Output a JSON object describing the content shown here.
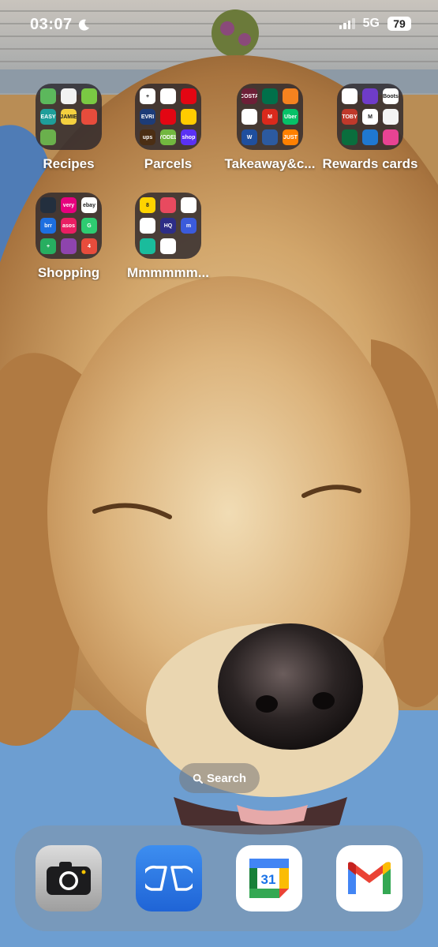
{
  "status_bar": {
    "time": "03:07",
    "network": "5G",
    "battery": "79"
  },
  "folders": [
    {
      "label": "Recipes",
      "apps": [
        {
          "name": "basket-app-icon",
          "color": "#5cb85c",
          "text": ""
        },
        {
          "name": "bowl-app-icon",
          "color": "#f2f2f2",
          "text": ""
        },
        {
          "name": "heart-app-icon",
          "color": "#7ac943",
          "text": ""
        },
        {
          "name": "easy-meals-app-icon",
          "color": "#1e9e9a",
          "text": "EASY"
        },
        {
          "name": "jamie-oliver-app-icon",
          "color": "#f4d03f",
          "text": "JAMIE"
        },
        {
          "name": "berry-app-icon",
          "color": "#e74c3c",
          "text": ""
        },
        {
          "name": "green-basket-app-icon",
          "color": "#6ab04c",
          "text": ""
        }
      ]
    },
    {
      "label": "Parcels",
      "apps": [
        {
          "name": "plus-app-icon",
          "color": "#ffffff",
          "text": "+"
        },
        {
          "name": "drop-app-icon",
          "color": "#ffffff",
          "text": ""
        },
        {
          "name": "royal-mail-app-icon",
          "color": "#e30613",
          "text": ""
        },
        {
          "name": "evri-app-icon",
          "color": "#1d3c78",
          "text": "EVRI"
        },
        {
          "name": "post-office-app-icon",
          "color": "#e30613",
          "text": ""
        },
        {
          "name": "dhl-app-icon",
          "color": "#ffcc00",
          "text": ""
        },
        {
          "name": "ups-app-icon",
          "color": "#4b2e14",
          "text": "ups"
        },
        {
          "name": "yodel-app-icon",
          "color": "#72b73f",
          "text": "YODEL"
        },
        {
          "name": "shop-app-icon",
          "color": "#5a31f4",
          "text": "shop"
        }
      ]
    },
    {
      "label": "Takeaway&c...",
      "apps": [
        {
          "name": "costa-app-icon",
          "color": "#6d1f37",
          "text": "COSTA"
        },
        {
          "name": "starbucks-app-icon",
          "color": "#00704a",
          "text": ""
        },
        {
          "name": "home-app-icon",
          "color": "#f5821f",
          "text": ""
        },
        {
          "name": "kfc-app-icon",
          "color": "#ffffff",
          "text": ""
        },
        {
          "name": "mcdonalds-app-icon",
          "color": "#da291c",
          "text": "M"
        },
        {
          "name": "uber-eats-app-icon",
          "color": "#06c167",
          "text": "Uber"
        },
        {
          "name": "wetherspoons-app-icon",
          "color": "#1f4f9e",
          "text": "W"
        },
        {
          "name": "grid-app-icon",
          "color": "#2c5aa0",
          "text": ""
        },
        {
          "name": "just-eat-app-icon",
          "color": "#ff8000",
          "text": "JUST"
        }
      ]
    },
    {
      "label": "Rewards cards",
      "apps": [
        {
          "name": "boots-app-icon",
          "color": "#ffffff",
          "text": ""
        },
        {
          "name": "bubble-app-icon",
          "color": "#6f3cc9",
          "text": ""
        },
        {
          "name": "boots-advantage-app-icon",
          "color": "#ffffff",
          "text": "Boots"
        },
        {
          "name": "toby-app-icon",
          "color": "#c0392b",
          "text": "TOBY"
        },
        {
          "name": "m-app-icon",
          "color": "#ffffff",
          "text": "M"
        },
        {
          "name": "card-app-icon",
          "color": "#f4f4f4",
          "text": ""
        },
        {
          "name": "green-card-app-icon",
          "color": "#0a6e3d",
          "text": ""
        },
        {
          "name": "flower-app-icon",
          "color": "#1f78d1",
          "text": ""
        },
        {
          "name": "diamond-app-icon",
          "color": "#e84393",
          "text": ""
        }
      ]
    },
    {
      "label": "Shopping",
      "apps": [
        {
          "name": "amazon-app-icon",
          "color": "#232f3e",
          "text": ""
        },
        {
          "name": "very-app-icon",
          "color": "#e6007e",
          "text": "very"
        },
        {
          "name": "ebay-app-icon",
          "color": "#ffffff",
          "text": "ebay"
        },
        {
          "name": "argos-app-icon",
          "color": "#1d6fe0",
          "text": "brr"
        },
        {
          "name": "asos-app-icon",
          "color": "#e91e63",
          "text": "asos"
        },
        {
          "name": "g-app-icon",
          "color": "#2ecc71",
          "text": "G"
        },
        {
          "name": "plus-green-app-icon",
          "color": "#27ae60",
          "text": "+"
        },
        {
          "name": "colour-app-icon",
          "color": "#8e44ad",
          "text": ""
        },
        {
          "name": "four-app-icon",
          "color": "#e74c3c",
          "text": "4"
        }
      ]
    },
    {
      "label": "Mmmmmm...",
      "apps": [
        {
          "name": "eight-app-icon",
          "color": "#ffd400",
          "text": "8"
        },
        {
          "name": "swirl-app-icon",
          "color": "#e84a5f",
          "text": ""
        },
        {
          "name": "leaf-app-icon",
          "color": "#ffffff",
          "text": ""
        },
        {
          "name": "pin-app-icon",
          "color": "#ffffff",
          "text": ""
        },
        {
          "name": "hq-app-icon",
          "color": "#2d2d86",
          "text": "HQ"
        },
        {
          "name": "m-blue-app-icon",
          "color": "#3b5bdb",
          "text": "m"
        },
        {
          "name": "target-app-icon",
          "color": "#1abc9c",
          "text": ""
        },
        {
          "name": "shield-app-icon",
          "color": "#ffffff",
          "text": ""
        }
      ]
    }
  ],
  "search": {
    "label": "Search"
  },
  "dock": {
    "calendar_day": "31"
  }
}
